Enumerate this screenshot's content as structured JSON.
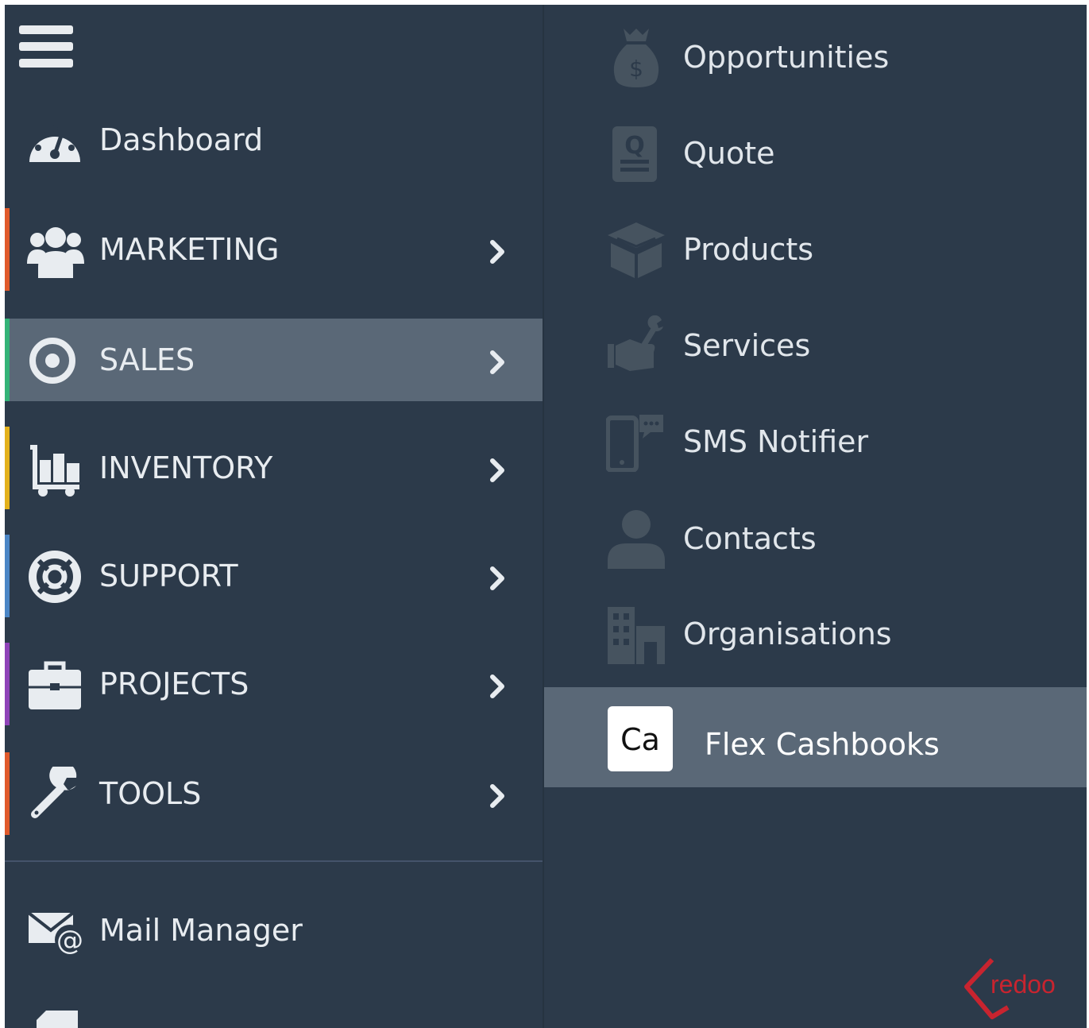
{
  "colors": {
    "background": "#2c3a4a",
    "active_background": "#5a6877",
    "icon_muted": "#46535f",
    "icon_light": "#e8ecf0",
    "logo_red": "#c8242f"
  },
  "left_menu": {
    "hamburger_icon": "hamburger-icon",
    "items": [
      {
        "label": "Dashboard",
        "icon": "dashboard-gauge-icon",
        "accent": null,
        "has_chevron": false
      },
      {
        "label": "MARKETING",
        "icon": "users-group-icon",
        "accent": "#e05a2b",
        "has_chevron": true
      },
      {
        "label": "SALES",
        "icon": "target-icon",
        "accent": "#33b377",
        "has_chevron": true,
        "active": true
      },
      {
        "label": "INVENTORY",
        "icon": "cart-boxes-icon",
        "accent": "#e3b11c",
        "has_chevron": true
      },
      {
        "label": "SUPPORT",
        "icon": "lifebuoy-icon",
        "accent": "#4b86c5",
        "has_chevron": true
      },
      {
        "label": "PROJECTS",
        "icon": "briefcase-icon",
        "accent": "#8f43b8",
        "has_chevron": true
      },
      {
        "label": "TOOLS",
        "icon": "wrench-icon",
        "accent": "#e05a2b",
        "has_chevron": true
      },
      {
        "label": "Mail Manager",
        "icon": "mail-at-icon",
        "accent": null,
        "has_chevron": false
      }
    ]
  },
  "sub_menu": {
    "items": [
      {
        "label": "Opportunities",
        "icon": "money-bag-icon"
      },
      {
        "label": "Quote",
        "icon": "quote-document-icon"
      },
      {
        "label": "Products",
        "icon": "product-box-icon"
      },
      {
        "label": "Services",
        "icon": "hand-wrench-icon"
      },
      {
        "label": "SMS Notifier",
        "icon": "phone-message-icon"
      },
      {
        "label": "Contacts",
        "icon": "person-icon"
      },
      {
        "label": "Organisations",
        "icon": "building-icon"
      },
      {
        "label": "Flex Cashbooks",
        "icon": "ca-badge-icon",
        "badge": "Ca",
        "active": true
      }
    ]
  },
  "logo": {
    "text": "redoo",
    "icon": "redoo-logo-icon"
  }
}
